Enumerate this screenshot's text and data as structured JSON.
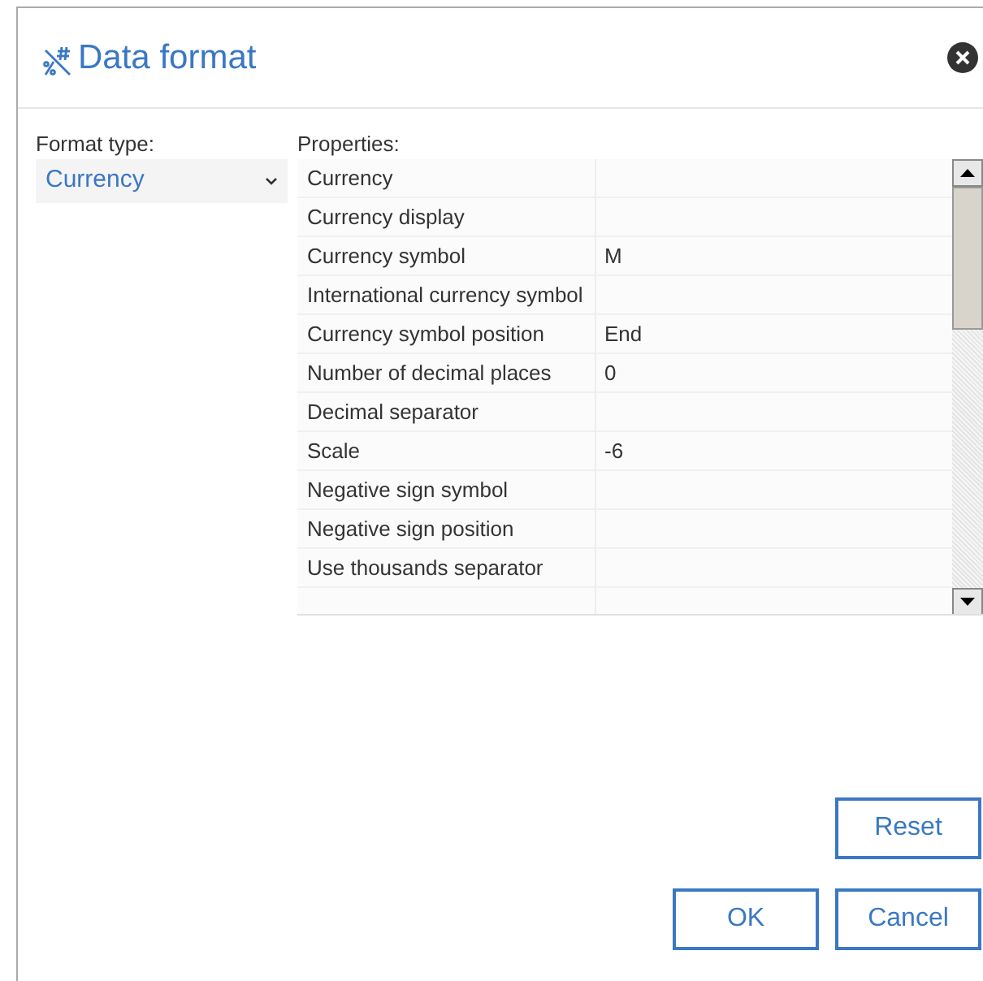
{
  "dialog": {
    "title": "Data format"
  },
  "format_type": {
    "label": "Format type:",
    "value": "Currency"
  },
  "properties": {
    "label": "Properties:",
    "rows": [
      {
        "name": "Currency",
        "value": ""
      },
      {
        "name": "Currency display",
        "value": ""
      },
      {
        "name": "Currency symbol",
        "value": "M"
      },
      {
        "name": "International currency symbol",
        "value": ""
      },
      {
        "name": "Currency symbol position",
        "value": "End"
      },
      {
        "name": "Number of decimal places",
        "value": "0"
      },
      {
        "name": "Decimal separator",
        "value": ""
      },
      {
        "name": "Scale",
        "value": "-6"
      },
      {
        "name": "Negative sign symbol",
        "value": ""
      },
      {
        "name": "Negative sign position",
        "value": ""
      },
      {
        "name": "Use thousands separator",
        "value": ""
      }
    ]
  },
  "buttons": {
    "reset": "Reset",
    "ok": "OK",
    "cancel": "Cancel"
  }
}
